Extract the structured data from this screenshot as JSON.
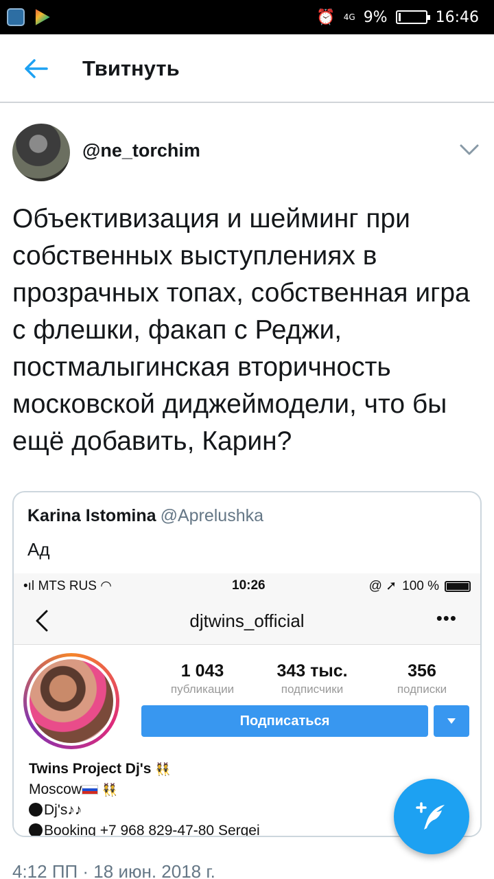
{
  "status_bar": {
    "time": "16:46",
    "battery": "9%",
    "network": "4G",
    "battery_level": 0.09
  },
  "header": {
    "title": "Твитнуть"
  },
  "tweet": {
    "handle": "@ne_torchim",
    "text": "Объективизация и шейминг при собственных выступлениях в прозрачных топах, собственная игра с флешки, факап с Реджи, постмалыгинская вторичность московской диджеймодели, что бы ещё добавить, Карин?",
    "timestamp": "4:12 ПП · 18 июн. 2018 г."
  },
  "quoted": {
    "name": "Karina Istomina",
    "username": "@Aprelushka",
    "text": "Ад",
    "screenshot": {
      "carrier": "MTS RUS",
      "time": "10:26",
      "battery": "100 %",
      "profile_name": "djtwins_official",
      "more": "•••",
      "stats": [
        {
          "value": "1 043",
          "label": "публикации"
        },
        {
          "value": "343 тыс.",
          "label": "подписчики"
        },
        {
          "value": "356",
          "label": "подписки"
        }
      ],
      "follow_button": "Подписаться",
      "bio": {
        "line1": "Twins Project Dj's",
        "line2": "Moscow",
        "line3": "Dj's",
        "line4": "Booking +7 968 829-47-80 Sergei"
      }
    }
  },
  "colors": {
    "accent": "#1da1f2",
    "text": "#14171a",
    "secondary": "#657786",
    "instagram_blue": "#3897f0"
  }
}
